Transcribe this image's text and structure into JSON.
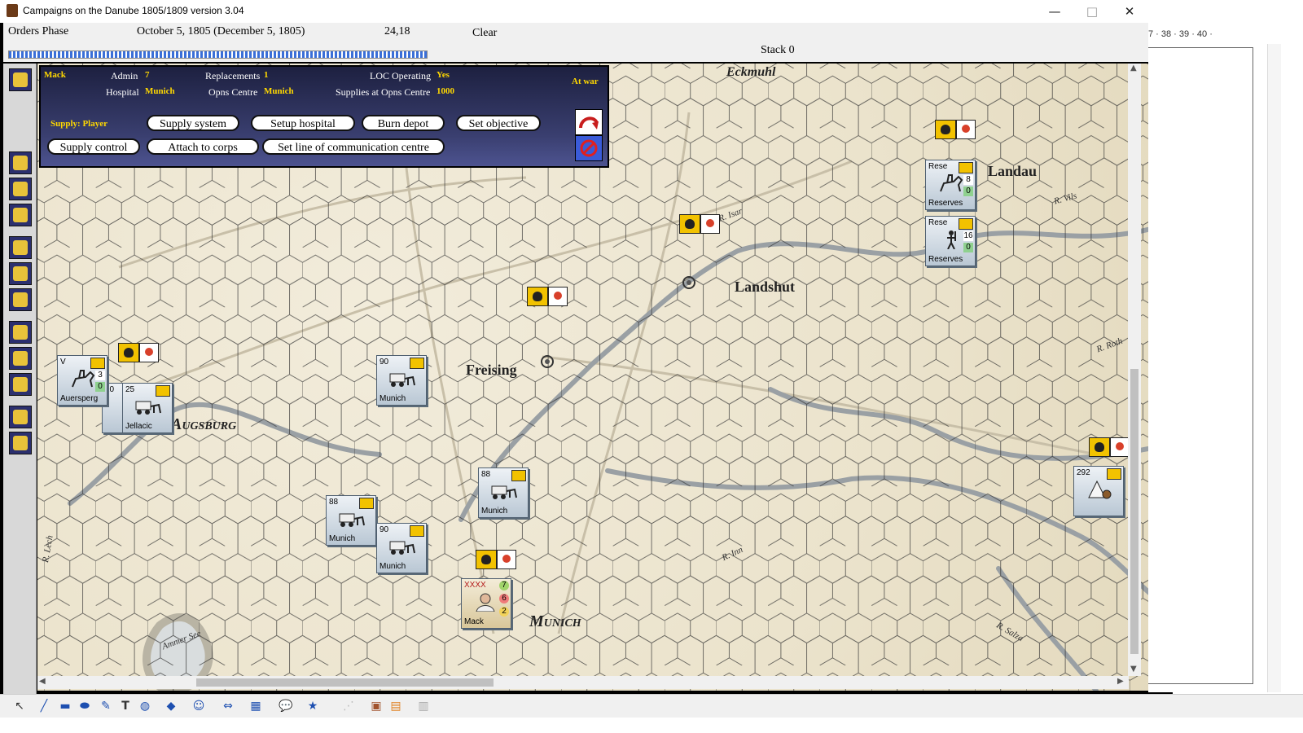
{
  "window": {
    "title": "Campaigns on the Danube 1805/1809  version 3.04",
    "minimize": "—",
    "maximize": "□",
    "close": "✕"
  },
  "status": {
    "phase": "Orders Phase",
    "date": "October 5, 1805 (December 5, 1805)",
    "coords": "24,18",
    "weather": "Clear",
    "stack": "Stack 0"
  },
  "panel": {
    "leader": "Mack",
    "admin_label": "Admin",
    "admin_value": "7",
    "replacements_label": "Replacements",
    "replacements_value": "1",
    "loc_label": "LOC Operating",
    "loc_value": "Yes",
    "war_status": "At war",
    "hospital_label": "Hospital",
    "hospital_value": "Munich",
    "opns_label": "Opns Centre",
    "opns_value": "Munich",
    "supplies_label": "Supplies at Opns Centre",
    "supplies_value": "1000",
    "supply_mode": "Supply: Player",
    "buttons": {
      "supply_system": "Supply system",
      "setup_hospital": "Setup hospital",
      "burn_depot": "Burn depot",
      "set_objective": "Set objective",
      "supply_control": "Supply control",
      "attach_to_corps": "Attach to corps",
      "set_loc_centre": "Set line of communication centre"
    }
  },
  "map": {
    "places": [
      "Eckmuhl",
      "Landau",
      "Landshut",
      "Freising",
      "Augsburg",
      "Munich"
    ],
    "rivers": [
      "R. Isar",
      "R. Vils",
      "R. Roth",
      "R. Inn",
      "R. Salza",
      "R. Lech"
    ],
    "lake": "Ammer See",
    "counters": [
      {
        "id": "auersperg",
        "top": "V",
        "name": "Auersperg",
        "s1": "3",
        "s2": "0",
        "type": "cavalry"
      },
      {
        "id": "jellacic",
        "top": "25",
        "name": "Jellacic",
        "extra": "20",
        "type": "supply-wagon"
      },
      {
        "id": "wagon-freising",
        "top": "90",
        "name": "Munich",
        "type": "supply-wagon"
      },
      {
        "id": "wagon-88a",
        "top": "88",
        "name": "Munich",
        "type": "supply-wagon"
      },
      {
        "id": "wagon-90b",
        "top": "90",
        "name": "Munich",
        "type": "supply-wagon"
      },
      {
        "id": "wagon-88b",
        "top": "88",
        "name": "Munich",
        "type": "supply-wagon"
      },
      {
        "id": "reserves-cav",
        "top": "Rese",
        "name": "Reserves",
        "s1": "8",
        "s2": "0",
        "type": "cavalry"
      },
      {
        "id": "reserves-inf",
        "top": "Rese",
        "name": "Reserves",
        "s1": "16",
        "s2": "0",
        "type": "infantry"
      },
      {
        "id": "depot-292",
        "top": "292",
        "name": "",
        "type": "depot"
      },
      {
        "id": "mack",
        "top": "XXXX",
        "name": "Mack",
        "s1": "7",
        "s2": "6",
        "s3": "2",
        "type": "leader"
      }
    ]
  },
  "ruler": "7 · 38 · 39 · 40 ·",
  "drawing_tools": [
    "select",
    "line",
    "rectangle",
    "ellipse",
    "pen",
    "text",
    "callout",
    "shape",
    "emoji",
    "arrows",
    "table",
    "speech",
    "star",
    "more",
    "camera",
    "image",
    "disabled"
  ],
  "colors": {
    "panel_bg": "#2a2e5a",
    "panel_value": "#ffd800",
    "map_bg": "#ebe3cc",
    "counter_bg": "#c9d4de",
    "flag_yellow": "#f2c200"
  }
}
